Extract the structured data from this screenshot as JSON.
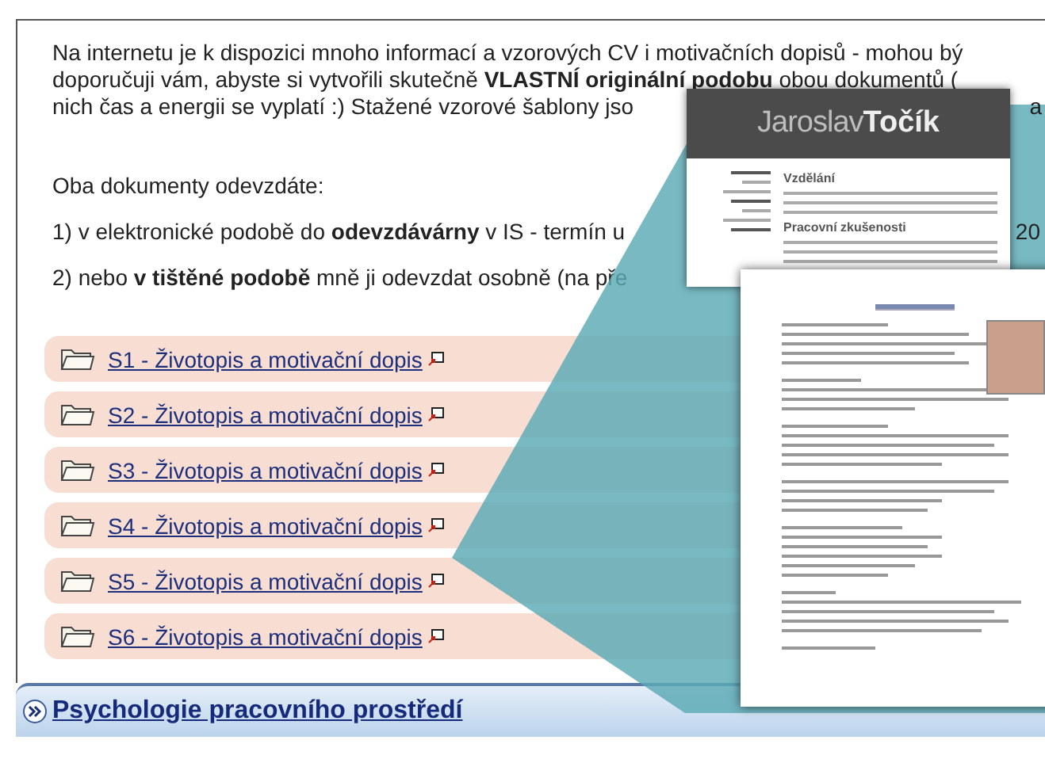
{
  "intro_lines": [
    {
      "text": "Na internetu je k dispozici mnoho informací a vzorových CV i motivačních dopisů - mohou bý"
    },
    {
      "text": "doporučuji vám, abyste si vytvořili skutečně **VLASTNÍ originální podobu** obou dokumentů ("
    },
    {
      "text": "nich čas a energii se vyplatí :) Stažené vzorové šablony jso",
      "tail": "a"
    }
  ],
  "instructions": {
    "heading": "Oba dokumenty odevzdáte:",
    "items": [
      {
        "text": "1) v elektronické podobě do **odevzdávárny** v IS - termín u",
        "tail": "20"
      },
      {
        "text": "2) nebo **v tištěné podobě** mně ji odevzdat osobně (na pře"
      }
    ]
  },
  "folders": [
    {
      "label": "S1 - Životopis a motivační dopis"
    },
    {
      "label": "S2 - Životopis a motivační dopis"
    },
    {
      "label": "S3 - Životopis a motivační dopis"
    },
    {
      "label": "S4 - Životopis a motivační dopis"
    },
    {
      "label": "S5 - Životopis a motivační dopis"
    },
    {
      "label": "S6 - Životopis a motivační dopis"
    }
  ],
  "next_section": {
    "label": "Psychologie pracovního prostředí"
  },
  "documents": [
    {
      "kind": "modern",
      "first_name": "Jaroslav",
      "last_name": "Točík",
      "sections": [
        "Vzdělání",
        "Pracovní zkušenosti"
      ]
    },
    {
      "kind": "classic"
    }
  ]
}
